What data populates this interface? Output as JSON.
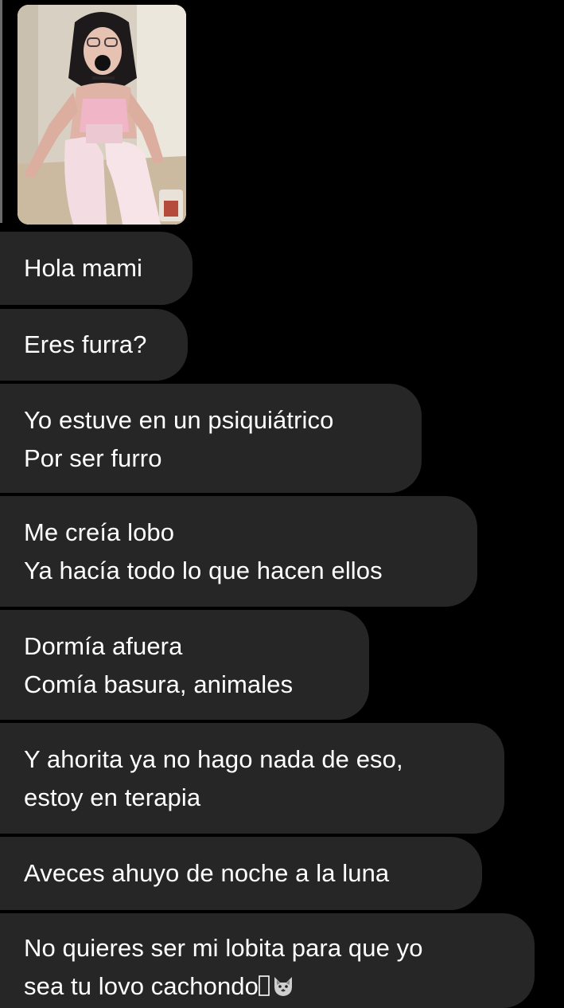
{
  "photo": {
    "icon": "sticker-icon"
  },
  "messages": [
    {
      "lines": [
        "Hola mami"
      ]
    },
    {
      "lines": [
        "Eres furra?"
      ]
    },
    {
      "lines": [
        "Yo estuve en un psiquiátrico",
        "Por ser furro"
      ]
    },
    {
      "lines": [
        "Me creía lobo",
        "Ya hacía todo lo que hacen ellos"
      ]
    },
    {
      "lines": [
        "Dormía afuera",
        "Comía basura, animales"
      ]
    },
    {
      "lines": [
        "Y ahorita ya no hago nada de eso,",
        "estoy en terapia"
      ]
    },
    {
      "lines": [
        "Aveces ahuyo de noche a la luna"
      ]
    },
    {
      "lines": [
        "No quieres ser mi lobita para que yo",
        "sea tu lovo cachondo"
      ],
      "trailing_icons": [
        "missing-glyph-icon",
        "wolf-icon"
      ]
    }
  ],
  "colors": {
    "background": "#000000",
    "bubble": "#262626",
    "text": "#ffffff"
  }
}
